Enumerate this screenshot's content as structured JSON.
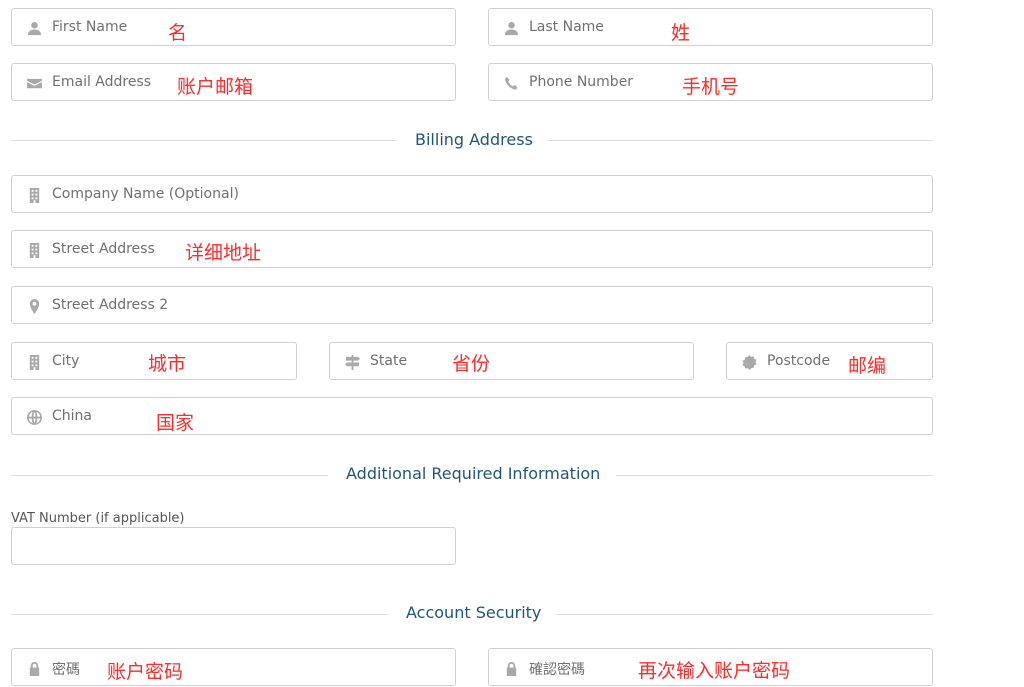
{
  "fields": {
    "first_name": {
      "placeholder": "First Name",
      "note": "名",
      "icon": "user-icon"
    },
    "last_name": {
      "placeholder": "Last Name",
      "note": "姓",
      "icon": "user-icon"
    },
    "email": {
      "placeholder": "Email Address",
      "note": "账户邮箱",
      "icon": "envelope-icon"
    },
    "phone": {
      "placeholder": "Phone Number",
      "note": "手机号",
      "icon": "phone-icon"
    },
    "company": {
      "placeholder": "Company Name (Optional)",
      "icon": "building-icon"
    },
    "street": {
      "placeholder": "Street Address",
      "note": "详细地址",
      "icon": "building-icon"
    },
    "street2": {
      "placeholder": "Street Address 2",
      "icon": "map-marker-icon"
    },
    "city": {
      "placeholder": "City",
      "note": "城市",
      "icon": "building-icon"
    },
    "state": {
      "placeholder": "State",
      "note": "省份",
      "icon": "signpost-icon"
    },
    "postcode": {
      "placeholder": "Postcode",
      "note": "邮编",
      "icon": "certificate-icon"
    },
    "country": {
      "placeholder": "China",
      "note": "国家",
      "icon": "globe-icon"
    },
    "vat": {
      "label": "VAT Number (if applicable)",
      "value": ""
    },
    "password": {
      "placeholder": "密碼",
      "note": "账户密码",
      "icon": "lock-icon"
    },
    "confirm_password": {
      "placeholder": "確認密碼",
      "note": "再次输入账户密码",
      "icon": "lock-icon"
    }
  },
  "sections": {
    "billing": "Billing Address",
    "additional": "Additional Required Information",
    "security": "Account Security"
  },
  "colors": {
    "section_title": "#22547a",
    "annotation": "#ff2a2a",
    "icon": "#a9a9a9",
    "border": "#d0d0d0"
  }
}
